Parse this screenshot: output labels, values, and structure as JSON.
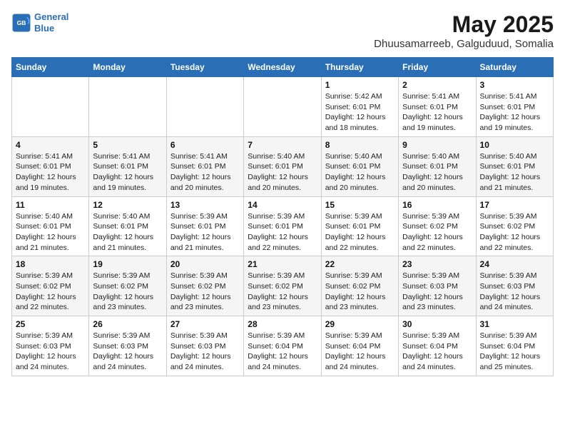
{
  "logo": {
    "line1": "General",
    "line2": "Blue"
  },
  "title": "May 2025",
  "location": "Dhuusamarreeb, Galguduud, Somalia",
  "days_of_week": [
    "Sunday",
    "Monday",
    "Tuesday",
    "Wednesday",
    "Thursday",
    "Friday",
    "Saturday"
  ],
  "weeks": [
    [
      {
        "day": "",
        "info": ""
      },
      {
        "day": "",
        "info": ""
      },
      {
        "day": "",
        "info": ""
      },
      {
        "day": "",
        "info": ""
      },
      {
        "day": "1",
        "info": "Sunrise: 5:42 AM\nSunset: 6:01 PM\nDaylight: 12 hours\nand 18 minutes."
      },
      {
        "day": "2",
        "info": "Sunrise: 5:41 AM\nSunset: 6:01 PM\nDaylight: 12 hours\nand 19 minutes."
      },
      {
        "day": "3",
        "info": "Sunrise: 5:41 AM\nSunset: 6:01 PM\nDaylight: 12 hours\nand 19 minutes."
      }
    ],
    [
      {
        "day": "4",
        "info": "Sunrise: 5:41 AM\nSunset: 6:01 PM\nDaylight: 12 hours\nand 19 minutes."
      },
      {
        "day": "5",
        "info": "Sunrise: 5:41 AM\nSunset: 6:01 PM\nDaylight: 12 hours\nand 19 minutes."
      },
      {
        "day": "6",
        "info": "Sunrise: 5:41 AM\nSunset: 6:01 PM\nDaylight: 12 hours\nand 20 minutes."
      },
      {
        "day": "7",
        "info": "Sunrise: 5:40 AM\nSunset: 6:01 PM\nDaylight: 12 hours\nand 20 minutes."
      },
      {
        "day": "8",
        "info": "Sunrise: 5:40 AM\nSunset: 6:01 PM\nDaylight: 12 hours\nand 20 minutes."
      },
      {
        "day": "9",
        "info": "Sunrise: 5:40 AM\nSunset: 6:01 PM\nDaylight: 12 hours\nand 20 minutes."
      },
      {
        "day": "10",
        "info": "Sunrise: 5:40 AM\nSunset: 6:01 PM\nDaylight: 12 hours\nand 21 minutes."
      }
    ],
    [
      {
        "day": "11",
        "info": "Sunrise: 5:40 AM\nSunset: 6:01 PM\nDaylight: 12 hours\nand 21 minutes."
      },
      {
        "day": "12",
        "info": "Sunrise: 5:40 AM\nSunset: 6:01 PM\nDaylight: 12 hours\nand 21 minutes."
      },
      {
        "day": "13",
        "info": "Sunrise: 5:39 AM\nSunset: 6:01 PM\nDaylight: 12 hours\nand 21 minutes."
      },
      {
        "day": "14",
        "info": "Sunrise: 5:39 AM\nSunset: 6:01 PM\nDaylight: 12 hours\nand 22 minutes."
      },
      {
        "day": "15",
        "info": "Sunrise: 5:39 AM\nSunset: 6:01 PM\nDaylight: 12 hours\nand 22 minutes."
      },
      {
        "day": "16",
        "info": "Sunrise: 5:39 AM\nSunset: 6:02 PM\nDaylight: 12 hours\nand 22 minutes."
      },
      {
        "day": "17",
        "info": "Sunrise: 5:39 AM\nSunset: 6:02 PM\nDaylight: 12 hours\nand 22 minutes."
      }
    ],
    [
      {
        "day": "18",
        "info": "Sunrise: 5:39 AM\nSunset: 6:02 PM\nDaylight: 12 hours\nand 22 minutes."
      },
      {
        "day": "19",
        "info": "Sunrise: 5:39 AM\nSunset: 6:02 PM\nDaylight: 12 hours\nand 23 minutes."
      },
      {
        "day": "20",
        "info": "Sunrise: 5:39 AM\nSunset: 6:02 PM\nDaylight: 12 hours\nand 23 minutes."
      },
      {
        "day": "21",
        "info": "Sunrise: 5:39 AM\nSunset: 6:02 PM\nDaylight: 12 hours\nand 23 minutes."
      },
      {
        "day": "22",
        "info": "Sunrise: 5:39 AM\nSunset: 6:02 PM\nDaylight: 12 hours\nand 23 minutes."
      },
      {
        "day": "23",
        "info": "Sunrise: 5:39 AM\nSunset: 6:03 PM\nDaylight: 12 hours\nand 23 minutes."
      },
      {
        "day": "24",
        "info": "Sunrise: 5:39 AM\nSunset: 6:03 PM\nDaylight: 12 hours\nand 24 minutes."
      }
    ],
    [
      {
        "day": "25",
        "info": "Sunrise: 5:39 AM\nSunset: 6:03 PM\nDaylight: 12 hours\nand 24 minutes."
      },
      {
        "day": "26",
        "info": "Sunrise: 5:39 AM\nSunset: 6:03 PM\nDaylight: 12 hours\nand 24 minutes."
      },
      {
        "day": "27",
        "info": "Sunrise: 5:39 AM\nSunset: 6:03 PM\nDaylight: 12 hours\nand 24 minutes."
      },
      {
        "day": "28",
        "info": "Sunrise: 5:39 AM\nSunset: 6:04 PM\nDaylight: 12 hours\nand 24 minutes."
      },
      {
        "day": "29",
        "info": "Sunrise: 5:39 AM\nSunset: 6:04 PM\nDaylight: 12 hours\nand 24 minutes."
      },
      {
        "day": "30",
        "info": "Sunrise: 5:39 AM\nSunset: 6:04 PM\nDaylight: 12 hours\nand 24 minutes."
      },
      {
        "day": "31",
        "info": "Sunrise: 5:39 AM\nSunset: 6:04 PM\nDaylight: 12 hours\nand 25 minutes."
      }
    ]
  ]
}
